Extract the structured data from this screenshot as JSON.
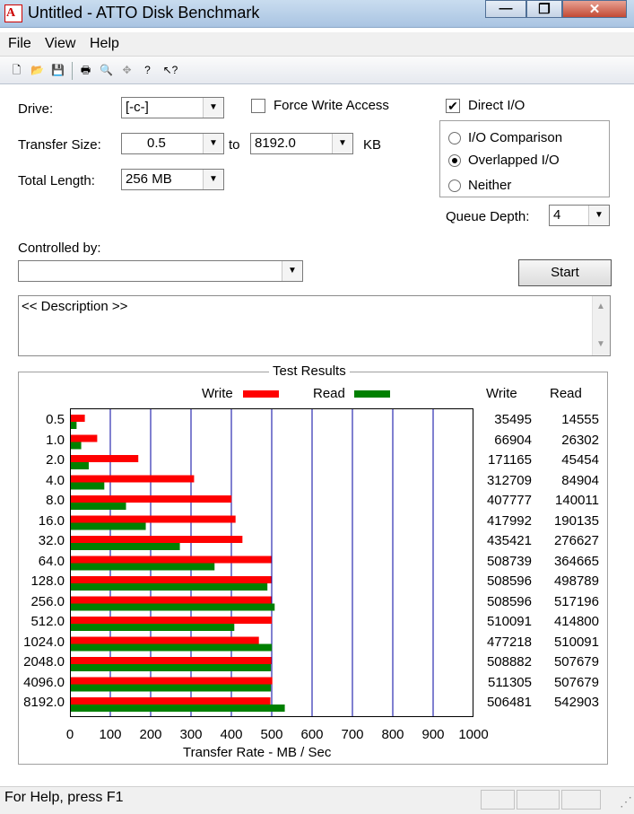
{
  "window": {
    "title": "Untitled - ATTO Disk Benchmark",
    "icon": "atto-icon",
    "icon_text": "A"
  },
  "window_buttons": {
    "minimize": "—",
    "maximize": "❐",
    "close": "✕"
  },
  "menu": [
    "File",
    "View",
    "Help"
  ],
  "toolbar": {
    "icons": [
      "new-icon",
      "open-icon",
      "save-icon",
      "print-icon",
      "print-preview-icon",
      "move-icon",
      "help-icon",
      "context-help-icon"
    ],
    "glyphs": [
      "🗋",
      "📂",
      "💾",
      "🖶",
      "🔍",
      "✥",
      "?",
      "↖?"
    ]
  },
  "settings": {
    "drive_label": "Drive:",
    "drive_value": "[-c-]",
    "force_write_label": "Force Write Access",
    "force_write_checked": false,
    "direct_io_label": "Direct I/O",
    "direct_io_checked": true,
    "check_mark": "✔",
    "transfer_size_label": "Transfer Size:",
    "transfer_from": "0.5",
    "to_label": "to",
    "transfer_to": "8192.0",
    "kb_label": "KB",
    "total_length_label": "Total Length:",
    "total_length_value": "256 MB",
    "io_options": [
      {
        "label": "I/O Comparison",
        "selected": false
      },
      {
        "label": "Overlapped I/O",
        "selected": true
      },
      {
        "label": "Neither",
        "selected": false
      }
    ],
    "queue_depth_label": "Queue Depth:",
    "queue_depth_value": "4",
    "controlled_by_label": "Controlled by:",
    "controlled_by_value": "",
    "start_label": "Start",
    "description": "<< Description >>",
    "dropdown_arrow": "▼",
    "scroll_up": "▲",
    "scroll_down": "▼"
  },
  "results": {
    "title": "Test Results",
    "legend_write": "Write",
    "legend_read": "Read",
    "col_write": "Write",
    "col_read": "Read",
    "write_color": "#ff0000",
    "read_color": "#008000",
    "grid_color": "#0000a0"
  },
  "chart_data": {
    "type": "bar",
    "orientation": "horizontal",
    "categories": [
      "0.5",
      "1.0",
      "2.0",
      "4.0",
      "8.0",
      "16.0",
      "32.0",
      "64.0",
      "128.0",
      "256.0",
      "512.0",
      "1024.0",
      "2048.0",
      "4096.0",
      "8192.0"
    ],
    "series": [
      {
        "name": "Write",
        "values": [
          35495,
          66904,
          171165,
          312709,
          407777,
          417992,
          435421,
          508739,
          508596,
          508596,
          510091,
          477218,
          508882,
          511305,
          506481
        ]
      },
      {
        "name": "Read",
        "values": [
          14555,
          26302,
          45454,
          84904,
          140011,
          190135,
          276627,
          364665,
          498789,
          517196,
          414800,
          510091,
          507679,
          507679,
          542903
        ]
      }
    ],
    "x_ticks": [
      "0",
      "100",
      "200",
      "300",
      "400",
      "500",
      "600",
      "700",
      "800",
      "900",
      "1000"
    ],
    "xlim": [
      0,
      1000
    ],
    "xlabel": "Transfer Rate - MB / Sec",
    "grid": true
  },
  "status": {
    "text": "For Help, press F1",
    "grip": "⋰"
  }
}
